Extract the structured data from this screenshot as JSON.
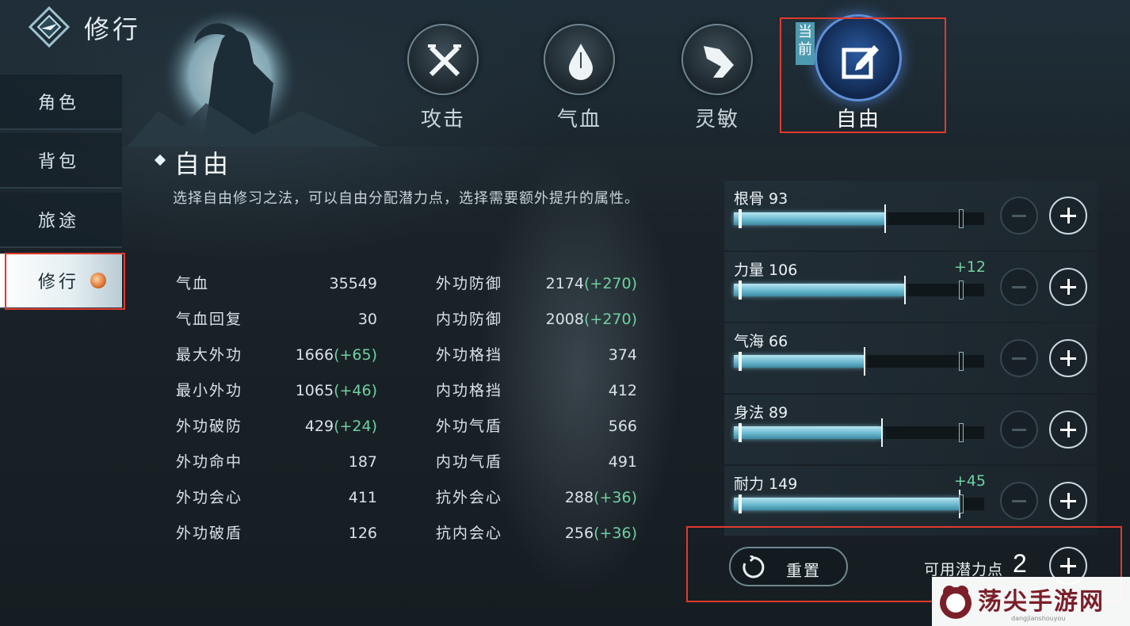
{
  "header": {
    "title": "修行"
  },
  "tabs": [
    {
      "label": "攻击",
      "icon": "crossed-swords-icon"
    },
    {
      "label": "气血",
      "icon": "drop-icon"
    },
    {
      "label": "灵敏",
      "icon": "wing-icon"
    },
    {
      "label": "自由",
      "icon": "edit-icon",
      "badge": "当前"
    }
  ],
  "sidebar": {
    "items": [
      {
        "label": "角色"
      },
      {
        "label": "背包"
      },
      {
        "label": "旅途"
      },
      {
        "label": "修行",
        "active": true
      }
    ]
  },
  "section": {
    "title": "自由",
    "description": "选择自由修习之法，可以自由分配潜力点，选择需要额外提升的属性。"
  },
  "stats_left": [
    {
      "name": "气血",
      "value": "35549",
      "bonus": ""
    },
    {
      "name": "气血回复",
      "value": "30",
      "bonus": ""
    },
    {
      "name": "最大外功",
      "value": "1666",
      "bonus": "(+65)"
    },
    {
      "name": "最小外功",
      "value": "1065",
      "bonus": "(+46)"
    },
    {
      "name": "外功破防",
      "value": "429",
      "bonus": "(+24)"
    },
    {
      "name": "外功命中",
      "value": "187",
      "bonus": ""
    },
    {
      "name": "外功会心",
      "value": "411",
      "bonus": ""
    },
    {
      "name": "外功破盾",
      "value": "126",
      "bonus": ""
    }
  ],
  "stats_right": [
    {
      "name": "外功防御",
      "value": "2174",
      "bonus": "(+270)"
    },
    {
      "name": "内功防御",
      "value": "2008",
      "bonus": "(+270)"
    },
    {
      "name": "外功格挡",
      "value": "374",
      "bonus": ""
    },
    {
      "name": "内功格挡",
      "value": "412",
      "bonus": ""
    },
    {
      "name": "外功气盾",
      "value": "566",
      "bonus": ""
    },
    {
      "name": "内功气盾",
      "value": "491",
      "bonus": ""
    },
    {
      "name": "抗外会心",
      "value": "288",
      "bonus": "(+36)"
    },
    {
      "name": "抗内会心",
      "value": "256",
      "bonus": "(+36)"
    }
  ],
  "attributes": [
    {
      "label": "根骨 93",
      "bonus": "",
      "fill": 0.6
    },
    {
      "label": "力量 106",
      "bonus": "+12",
      "fill": 0.68
    },
    {
      "label": "气海 66",
      "bonus": "",
      "fill": 0.52
    },
    {
      "label": "身法 89",
      "bonus": "",
      "fill": 0.59
    },
    {
      "label": "耐力 149",
      "bonus": "+45",
      "fill": 0.9
    }
  ],
  "bottom": {
    "reset_label": "重置",
    "points_label": "可用潜力点",
    "points_value": "2"
  },
  "watermark": {
    "text": "荡尖手游网",
    "sub": "dangjianshouyou"
  },
  "colors": {
    "bonus": "#6fd1a0",
    "highlight": "#e03a2e",
    "accent": "#5e90d8"
  }
}
